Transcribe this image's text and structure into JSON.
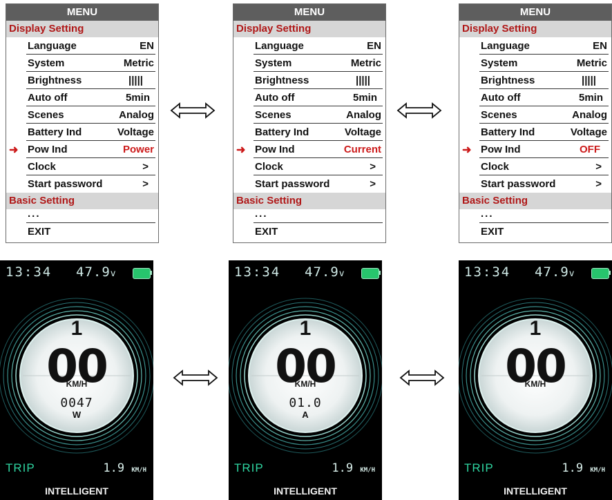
{
  "menu": {
    "title": "MENU",
    "display_section": "Display Setting",
    "basic_section": "Basic Setting",
    "dots": "...",
    "exit": "EXIT",
    "items": [
      {
        "label": "Language",
        "value": "EN"
      },
      {
        "label": "System",
        "value": "Metric"
      },
      {
        "label": "Brightness",
        "value": "|||||"
      },
      {
        "label": "Auto off",
        "value": "5min"
      },
      {
        "label": "Scenes",
        "value": "Analog"
      },
      {
        "label": "Battery Ind",
        "value": "Voltage"
      },
      {
        "label": "Pow Ind",
        "value": ""
      },
      {
        "label": "Clock",
        "value": ">"
      },
      {
        "label": "Start password",
        "value": ">"
      }
    ],
    "pointer_icon": "right-arrow-icon",
    "pow_ind_options": [
      "Power",
      "Current",
      "OFF"
    ]
  },
  "arrows": {
    "icon": "double-arrow-icon"
  },
  "screens": [
    {
      "time": "13:34",
      "voltage": "47.9",
      "voltage_unit": "v",
      "gear": "1",
      "speed": "00",
      "speed_unit": "KM/H",
      "pow_value": "0047",
      "pow_unit": "W",
      "trip_label": "TRIP",
      "trip_value": "1.9",
      "trip_unit": "KM/H",
      "mode": "INTELLIGENT"
    },
    {
      "time": "13:34",
      "voltage": "47.9",
      "voltage_unit": "v",
      "gear": "1",
      "speed": "00",
      "speed_unit": "KM/H",
      "pow_value": "01.0",
      "pow_unit": "A",
      "trip_label": "TRIP",
      "trip_value": "1.9",
      "trip_unit": "KM/H",
      "mode": "INTELLIGENT"
    },
    {
      "time": "13:34",
      "voltage": "47.9",
      "voltage_unit": "v",
      "gear": "1",
      "speed": "00",
      "speed_unit": "KM/H",
      "pow_value": "",
      "pow_unit": "",
      "trip_label": "TRIP",
      "trip_value": "1.9",
      "trip_unit": "KM/H",
      "mode": "INTELLIGENT"
    }
  ],
  "colors": {
    "accent_red": "#cc1a1a",
    "menu_title_bg": "#5e5e5e",
    "section_bg": "#d6d6d6",
    "battery": "#27c56d",
    "trip": "#2fd6a2"
  }
}
